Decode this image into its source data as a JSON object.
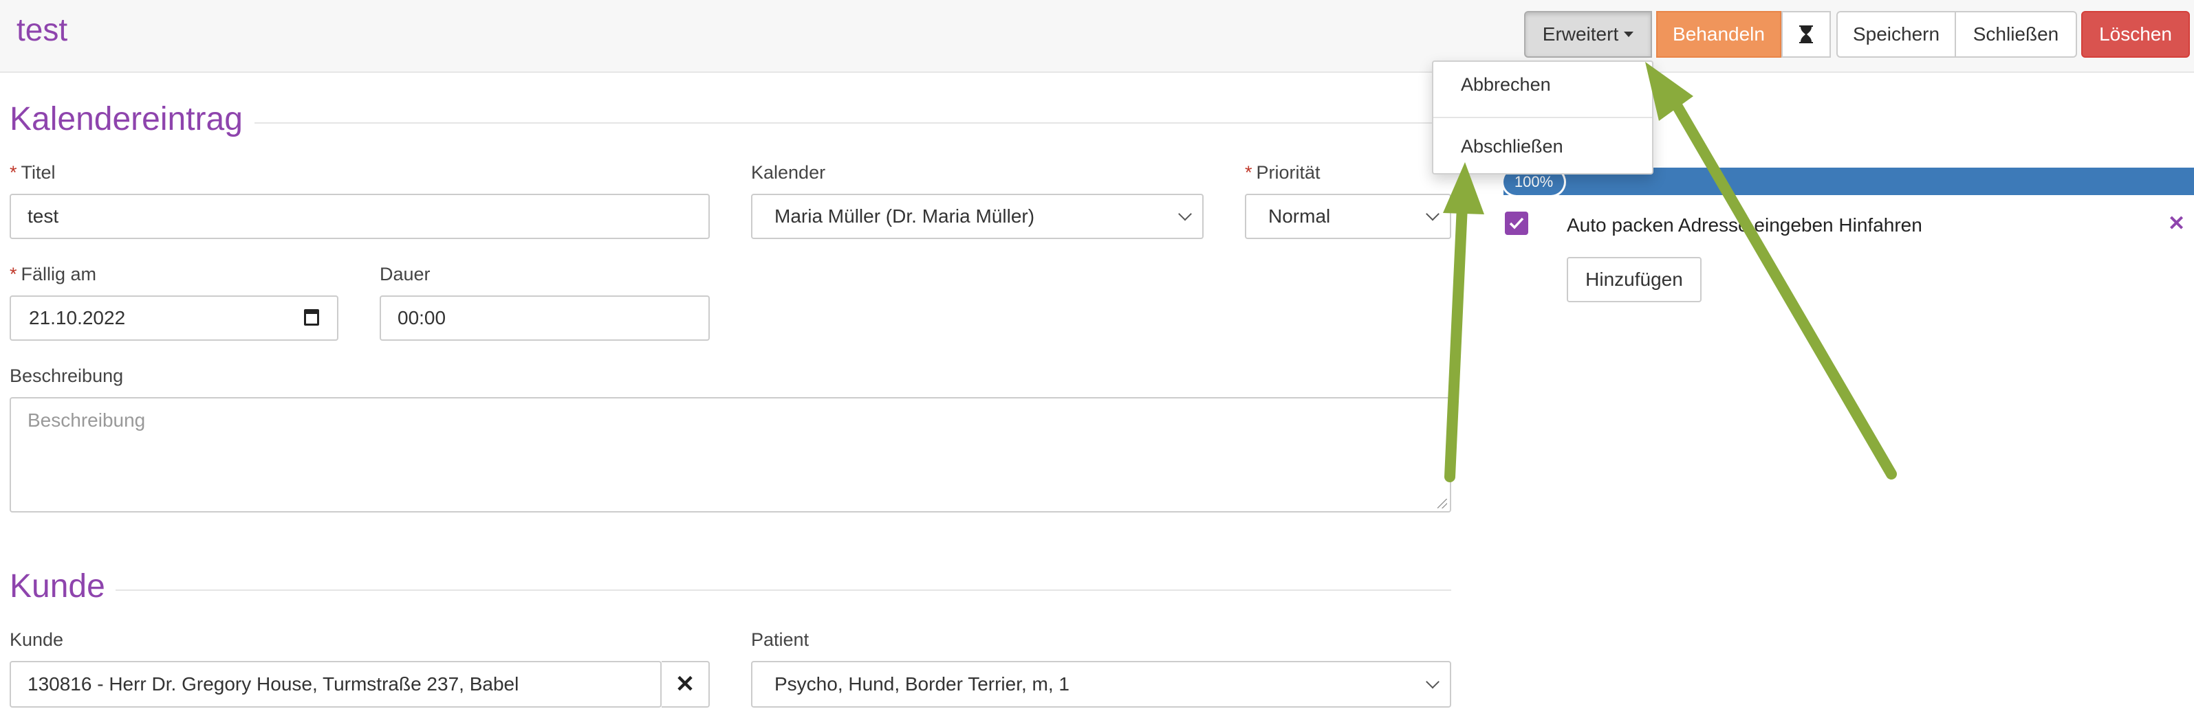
{
  "header": {
    "title": "test",
    "buttons": {
      "erweitert": "Erweitert",
      "behandeln": "Behandeln",
      "speichern": "Speichern",
      "schliessen": "Schließen",
      "loeschen": "Löschen"
    }
  },
  "dropdown": {
    "items": [
      "Abbrechen",
      "Abschließen"
    ]
  },
  "section_entry": {
    "title": "Kalendereintrag",
    "titel": {
      "label": "Titel",
      "value": "test"
    },
    "kalender": {
      "label": "Kalender",
      "value": "Maria Müller (Dr. Maria Müller)"
    },
    "prioritaet": {
      "label": "Priorität",
      "value": "Normal"
    },
    "faellig": {
      "label": "Fällig am",
      "value": "21.10.2022"
    },
    "dauer": {
      "label": "Dauer",
      "value": "00:00"
    },
    "beschreibung": {
      "label": "Beschreibung",
      "placeholder": "Beschreibung"
    }
  },
  "section_kunde": {
    "title": "Kunde",
    "kunde": {
      "label": "Kunde",
      "value": "130816 - Herr Dr. Gregory House, Turmstraße 237, Babel"
    },
    "patient": {
      "label": "Patient",
      "value": "Psycho, Hund, Border Terrier, m, 1"
    }
  },
  "tasks": {
    "progress_label": "100%",
    "progress_value": 1.0,
    "items": [
      {
        "text": "Auto packen Adresse eingeben Hinfahren",
        "checked": true
      }
    ],
    "add_label": "Hinzufügen"
  },
  "colors": {
    "accent": "#8e44ad",
    "behandeln": "#f0955b",
    "danger": "#d9534f",
    "progress": "#3d7ab8",
    "annotation_arrow": "#8aab3c"
  },
  "icons": [
    "caret-down-icon",
    "hourglass-icon",
    "calendar-icon",
    "chevron-down-icon",
    "clear-icon",
    "check-icon",
    "close-icon"
  ]
}
